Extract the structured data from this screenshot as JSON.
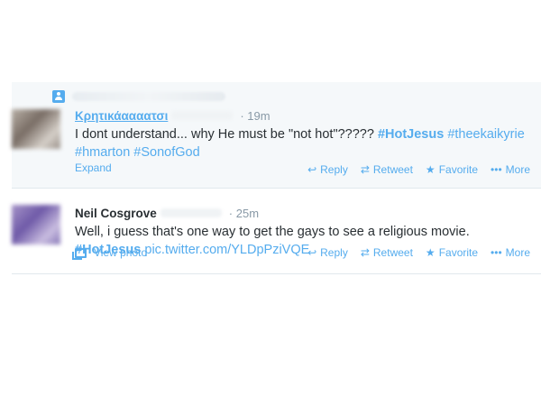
{
  "tweets": [
    {
      "author_name": "Κρητικάαααατσι",
      "time": "19m",
      "text_plain": "I dont understand... why He must be \"not hot\"????? ",
      "hashtags": [
        "#HotJesus",
        "#theekaikyrie",
        "#hmarton",
        "#SonofGod"
      ],
      "footer_link": "Expand",
      "actions": {
        "reply": "Reply",
        "retweet": "Retweet",
        "favorite": "Favorite",
        "more": "More"
      }
    },
    {
      "author_name": "Neil Cosgrove",
      "time": "25m",
      "text_plain": "Well, i guess that's one way to get the gays to see a religious movie.",
      "hashtag": "#HotJesus",
      "link": "pic.twitter.com/YLDpPziVQE",
      "footer_link": "View photo",
      "actions": {
        "reply": "Reply",
        "retweet": "Retweet",
        "favorite": "Favorite",
        "more": "More"
      }
    }
  ],
  "icons": {
    "reply": "reply-arrow-icon",
    "retweet": "retweet-icon",
    "favorite": "star-icon",
    "more": "ellipsis-icon",
    "photo": "photo-icon",
    "person": "person-icon"
  },
  "colors": {
    "accent": "#55acee",
    "muted": "#8899a6",
    "text": "#292f33",
    "highlight_bg": "#f5f8fa"
  }
}
